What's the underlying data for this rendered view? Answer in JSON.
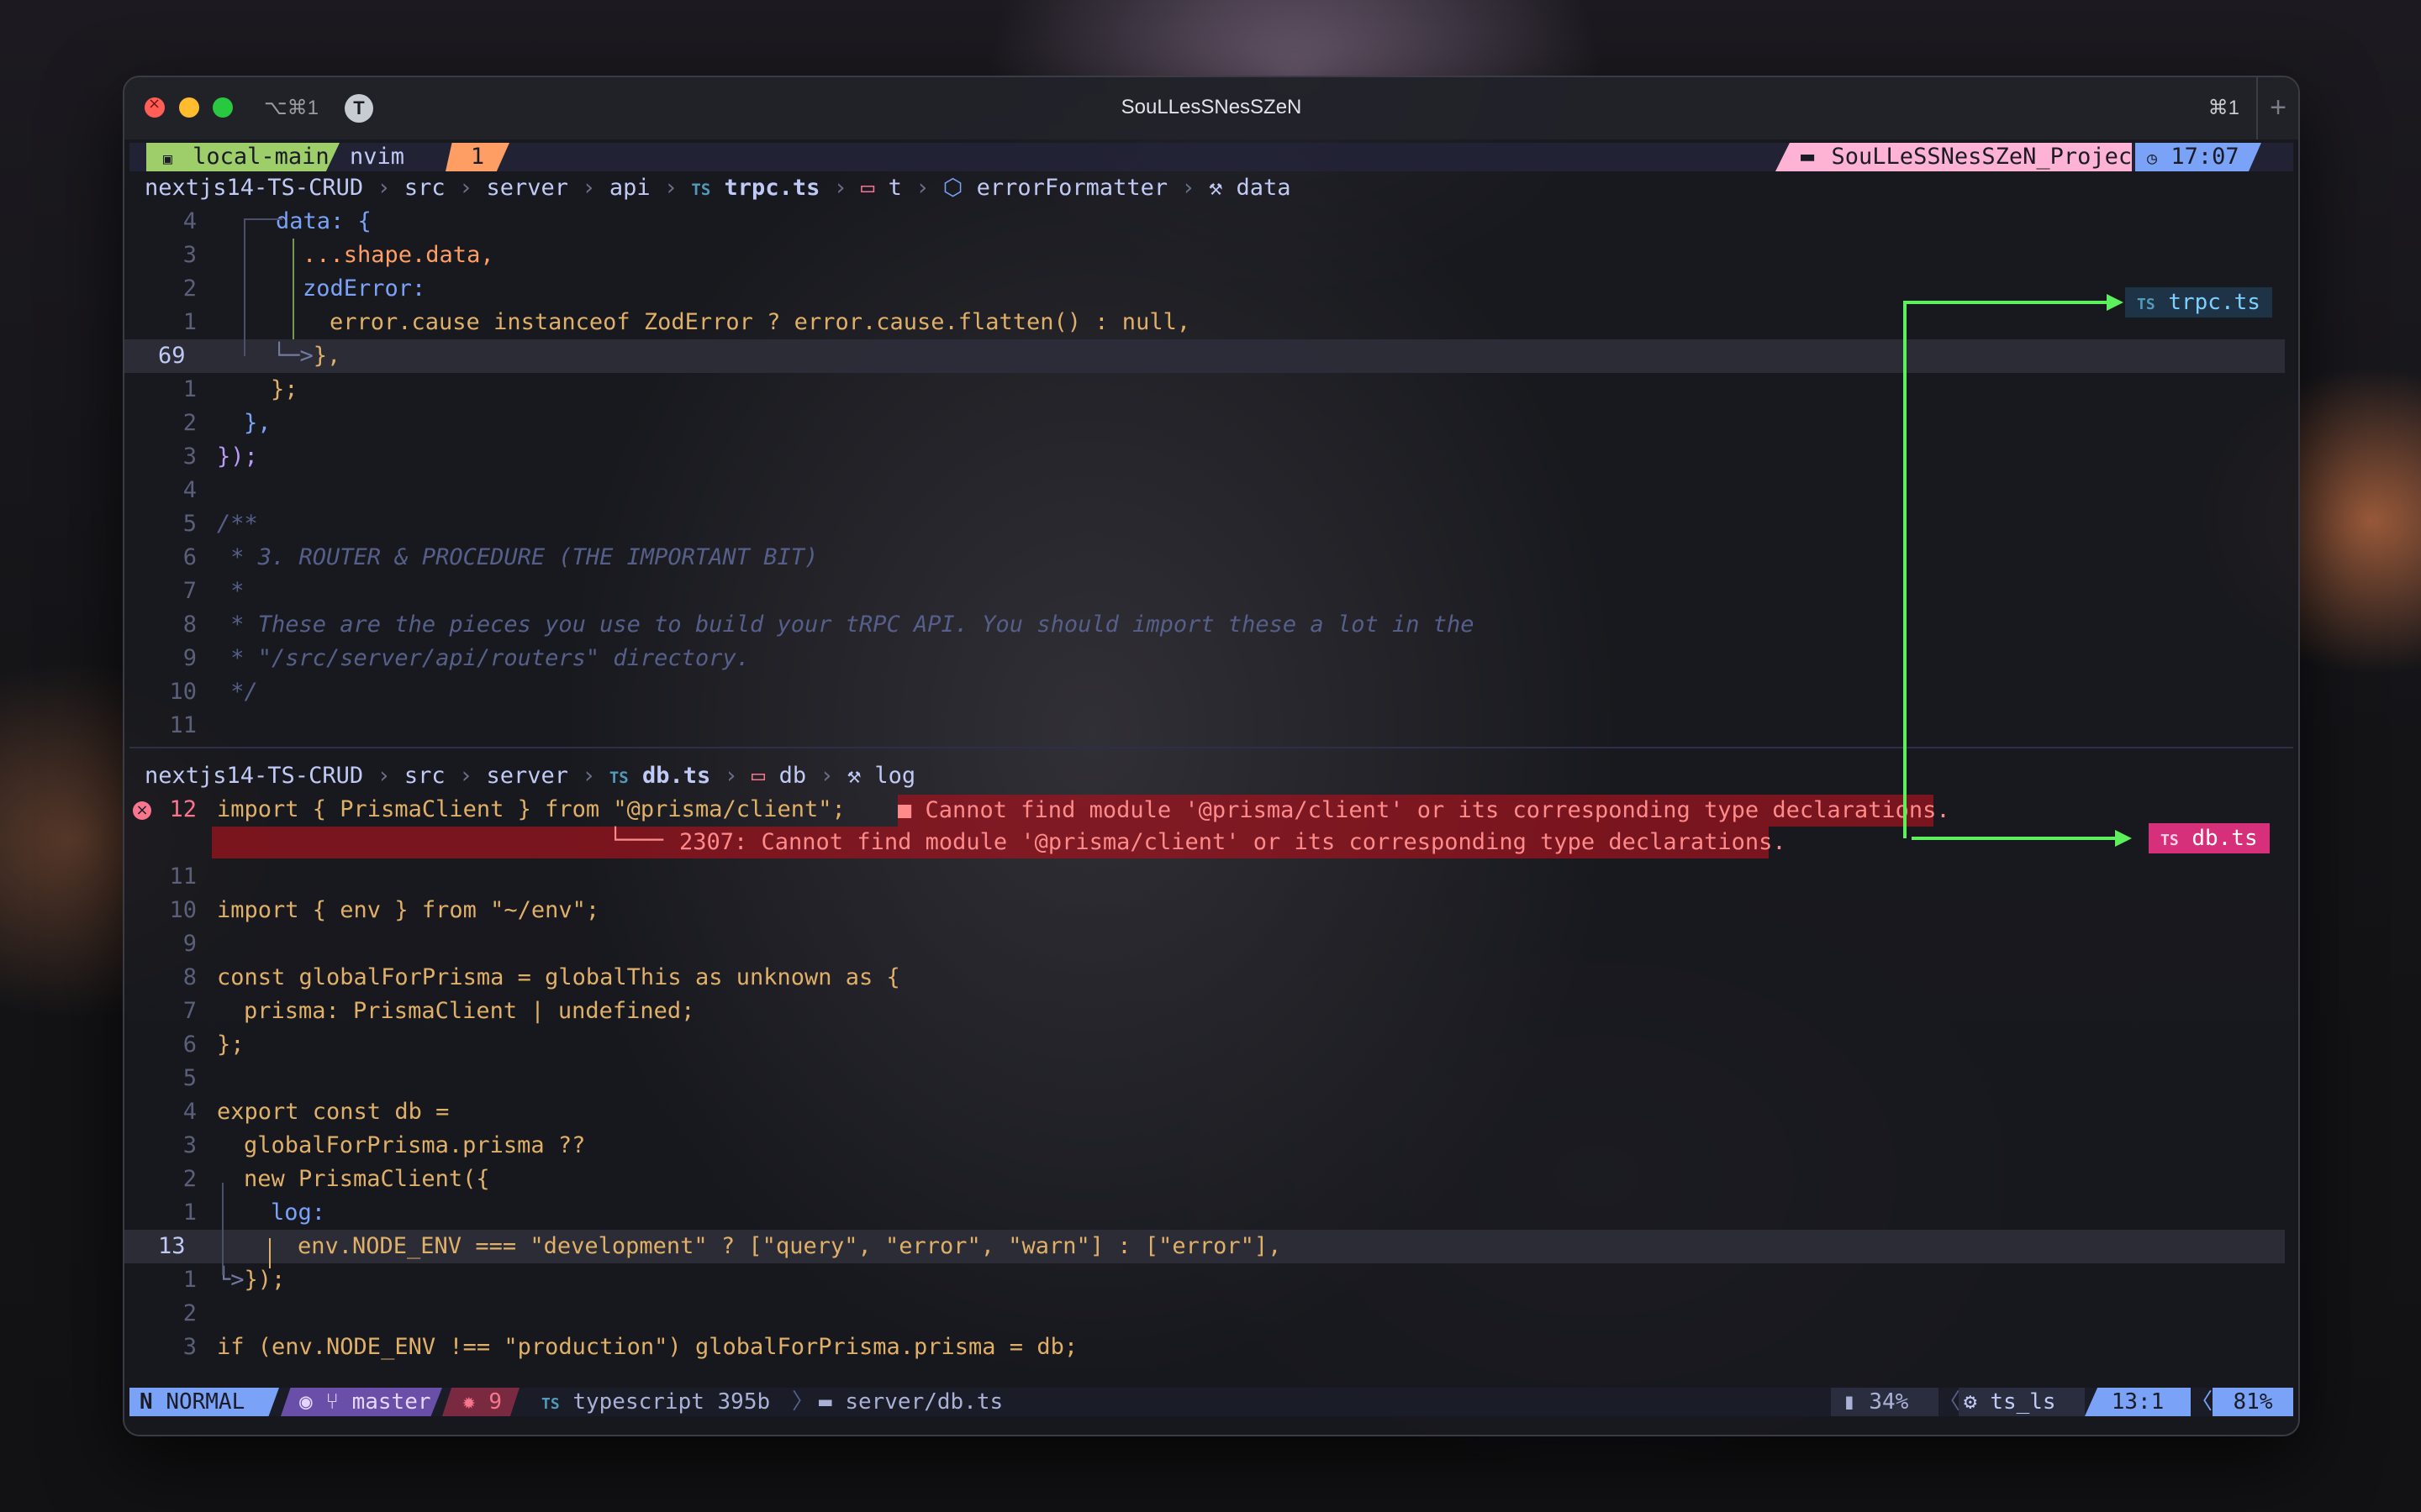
{
  "window": {
    "title": "SouLLesSNesSZeN",
    "shortcut": "⌥⌘1",
    "app_icon_letter": "T",
    "tab_shortcut": "⌘1",
    "new_tab": "+"
  },
  "tmux": {
    "session": "local-main",
    "window_name": "nvim",
    "window_index": "1",
    "project": "SouLLeSSNesSZeN_Projects",
    "time": "17:07"
  },
  "top_pane": {
    "breadcrumb": [
      "nextjs14-TS-CRUD",
      "src",
      "server",
      "api",
      "trpc.ts",
      "t",
      "errorFormatter",
      "data"
    ],
    "file_icon": "TS",
    "current_line": "69",
    "float_label": "trpc.ts"
  },
  "bottom_pane": {
    "breadcrumb": [
      "nextjs14-TS-CRUD",
      "src",
      "server",
      "db.ts",
      "db",
      "log"
    ],
    "file_icon": "TS",
    "current_line": "13",
    "float_label": "db.ts",
    "diagnostic_inline": "■ Cannot find module '@prisma/client' or its corresponding type declarations.",
    "diagnostic_virtual": "2307: Cannot find module '@prisma/client' or its corresponding type declarations."
  },
  "code_top": [
    {
      "n": "4",
      "code": "data: {"
    },
    {
      "n": "3",
      "code": "...shape.data,"
    },
    {
      "n": "2",
      "code": "zodError:"
    },
    {
      "n": "1",
      "code": "error.cause instanceof ZodError ? error.cause.flatten() : null,"
    },
    {
      "n": "69",
      "code": "},"
    },
    {
      "n": "1",
      "code": "};"
    },
    {
      "n": "2",
      "code": "},"
    },
    {
      "n": "3",
      "code": "});"
    },
    {
      "n": "4",
      "code": ""
    },
    {
      "n": "5",
      "code": "/**"
    },
    {
      "n": "6",
      "code": " * 3. ROUTER & PROCEDURE (THE IMPORTANT BIT)"
    },
    {
      "n": "7",
      "code": " *"
    },
    {
      "n": "8",
      "code": " * These are the pieces you use to build your tRPC API. You should import these a lot in the"
    },
    {
      "n": "9",
      "code": " * \"/src/server/api/routers\" directory."
    },
    {
      "n": "10",
      "code": " */"
    },
    {
      "n": "11",
      "code": ""
    }
  ],
  "code_bottom": [
    {
      "n": "12",
      "code": "import { PrismaClient } from \"@prisma/client\";"
    },
    {
      "n": "11",
      "code": ""
    },
    {
      "n": "10",
      "code": "import { env } from \"~/env\";"
    },
    {
      "n": "9",
      "code": ""
    },
    {
      "n": "8",
      "code": "const globalForPrisma = globalThis as unknown as {"
    },
    {
      "n": "7",
      "code": "prisma: PrismaClient | undefined;"
    },
    {
      "n": "6",
      "code": "};"
    },
    {
      "n": "5",
      "code": ""
    },
    {
      "n": "4",
      "code": "export const db ="
    },
    {
      "n": "3",
      "code": "globalForPrisma.prisma ??"
    },
    {
      "n": "2",
      "code": "new PrismaClient({"
    },
    {
      "n": "1",
      "code": "log:"
    },
    {
      "n": "13",
      "code": "env.NODE_ENV === \"development\" ? [\"query\", \"error\", \"warn\"] : [\"error\"],"
    },
    {
      "n": "1",
      "code": "});"
    },
    {
      "n": "2",
      "code": ""
    },
    {
      "n": "3",
      "code": "if (env.NODE_ENV !== \"production\") globalForPrisma.prisma = db;"
    }
  ],
  "statusline": {
    "mode": "NORMAL",
    "branch": "master",
    "errors": "9",
    "filetype": "typescript 395b",
    "path": "server/db.ts",
    "battery": "34%",
    "lsp": "ts_ls",
    "position": "13:1",
    "percent": "81%"
  },
  "colors": {
    "session_green": "#9ece6a",
    "index_orange": "#ff9e64",
    "project_pink": "#ffb3d4",
    "time_blue": "#7aa2f7",
    "mode_blue": "#7aa2f7",
    "branch_purple": "#bb9af7",
    "error_red": "#f7768e",
    "arrow_green": "#5df05d",
    "float_db_pink": "#d6307a"
  }
}
